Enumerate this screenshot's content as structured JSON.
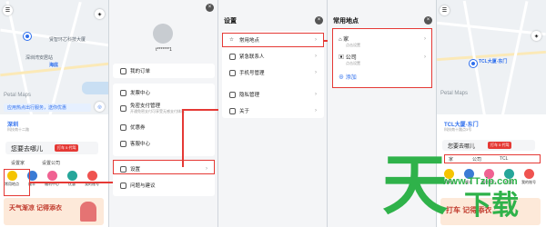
{
  "panel1": {
    "map_brand": "Petal Maps",
    "place_label": "海底",
    "map_labels": [
      "贤智环芯科技大厦",
      "深圳湾安居站"
    ],
    "banner_text": "应用热点出行服务，送你优惠",
    "location_name": "深圳",
    "location_sub": "科技南十二路",
    "search_placeholder": "您要去哪儿",
    "search_tag": "打车 5 代驾",
    "quick_links": [
      "设置家",
      "设置公司"
    ],
    "shortcuts": [
      {
        "label": "常用地点",
        "color": "#f5c400"
      },
      {
        "label": "顺丰",
        "color": "#3a7bd5"
      },
      {
        "label": "福利中心",
        "color": "#f06292"
      },
      {
        "label": "优惠",
        "color": "#26a69a"
      },
      {
        "label": "我的账号",
        "color": "#ef5350"
      }
    ],
    "ad_text": "天气渐凉 记得添衣"
  },
  "panel2": {
    "username": "t*******1",
    "menu": [
      {
        "label": "我的订单",
        "sub": ""
      },
      {
        "label": "发票中心",
        "sub": ""
      },
      {
        "label": "免密支付管理",
        "sub": "开通免密支付可享受无感支付体验"
      },
      {
        "label": "优惠券",
        "sub": ""
      },
      {
        "label": "客服中心",
        "sub": ""
      },
      {
        "label": "设置",
        "sub": ""
      },
      {
        "label": "问题与建议",
        "sub": ""
      }
    ]
  },
  "panel3": {
    "title": "设置",
    "items": [
      {
        "label": "常用地点",
        "icon": "star-icon"
      },
      {
        "label": "紧急联系人",
        "icon": "contact-icon"
      },
      {
        "label": "手机号管理",
        "icon": "phone-icon"
      },
      {
        "label": "隐私管理",
        "icon": "privacy-icon"
      },
      {
        "label": "关于",
        "icon": "info-icon"
      }
    ]
  },
  "panel4": {
    "title": "常用地点",
    "places": [
      {
        "name": "家",
        "sub": "点击设置",
        "icon": "home-icon"
      },
      {
        "name": "公司",
        "sub": "点击设置",
        "icon": "briefcase-icon"
      }
    ],
    "add_label": "添加"
  },
  "panel5": {
    "map_brand": "Petal Maps",
    "place_label": "TCL大厦-东门",
    "location_name": "TCL大厦-东门",
    "location_sub": "科技南十路点3号",
    "search_placeholder": "您要去哪儿",
    "search_tag": "打车 5 代驾",
    "quick_links": [
      "家",
      "公司",
      "TCL"
    ],
    "shortcuts": [
      "常用地点",
      "顺丰",
      "福利中心",
      "优惠",
      "我的账号"
    ],
    "ad_text": "打车 记得添衣"
  },
  "watermark": {
    "big": "天",
    "url": "www.TTzip.com",
    "tail": "下载"
  },
  "colors": {
    "accent": "#e53935",
    "blue": "#2f6fed",
    "watermark": "#2fb24a"
  }
}
